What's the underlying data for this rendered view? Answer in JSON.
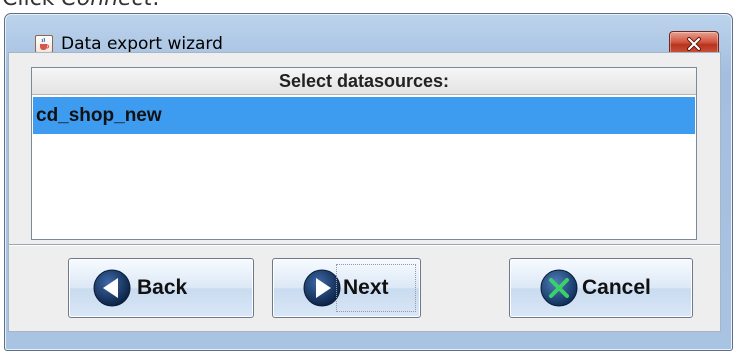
{
  "caption": {
    "prefix": "Click ",
    "emphasis": "Connect",
    "suffix": "."
  },
  "window": {
    "title": "Data export wizard",
    "icons": {
      "app": "java-cup-icon",
      "close": "close-icon"
    }
  },
  "list": {
    "header": "Select datasources:",
    "items": [
      "cd_shop_new"
    ],
    "selected_index": 0,
    "selection_color": "#3d9bf0"
  },
  "buttons": {
    "back": {
      "label": "Back",
      "icon": "arrow-left-icon"
    },
    "next": {
      "label": "Next",
      "icon": "arrow-right-icon"
    },
    "cancel": {
      "label": "Cancel",
      "icon": "cancel-x-icon"
    }
  }
}
